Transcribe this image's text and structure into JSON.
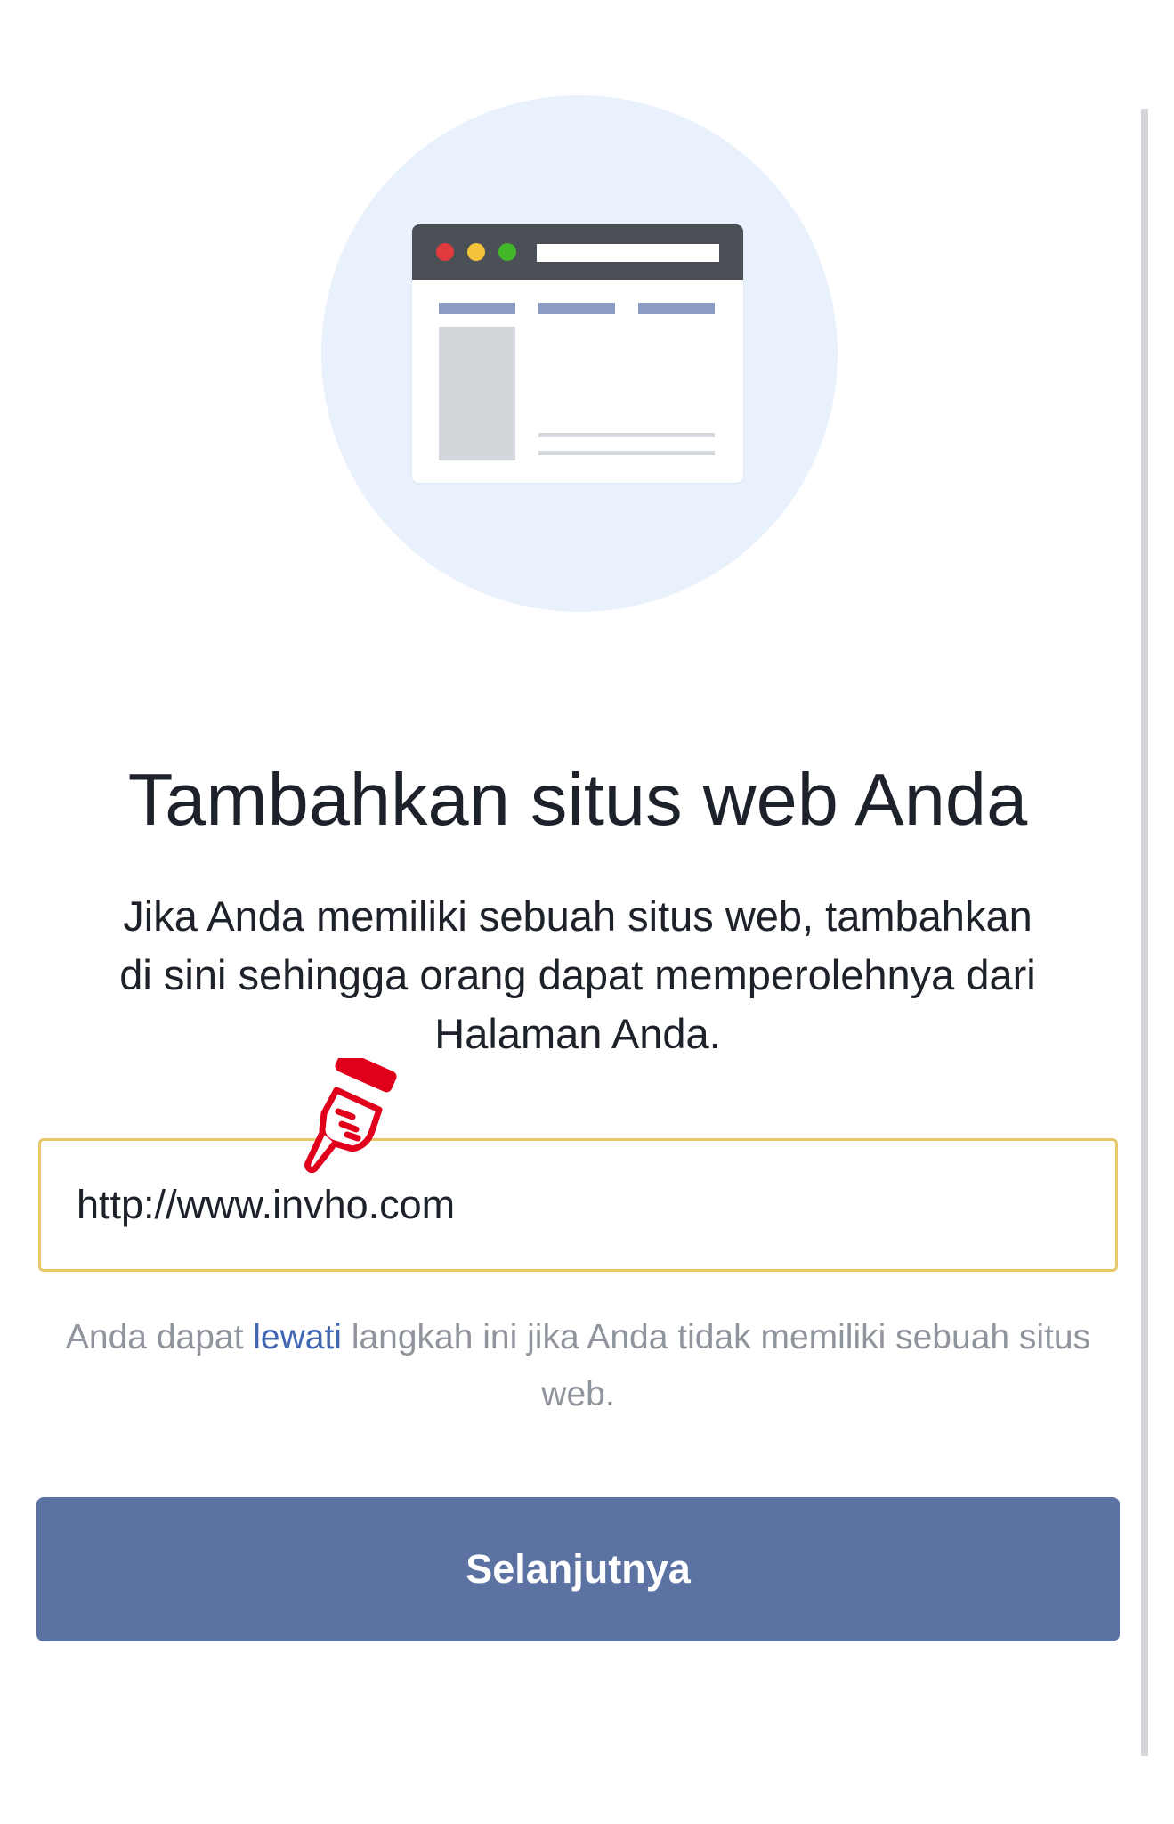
{
  "illustration": {
    "icon": "browser-window-icon",
    "colors": {
      "circle": "#e9f1fd",
      "window_bar": "#4b4f56",
      "dot_red": "#e0393e",
      "dot_yellow": "#f5c33b",
      "dot_green": "#42b72a",
      "nav_lines": "#8b9dc3",
      "placeholder_blocks": "#d3d6db"
    }
  },
  "heading": {
    "title": "Tambahkan situs web Anda",
    "description": "Jika Anda memiliki sebuah situs web, tambahkan di sini sehingga orang dapat memperolehnya dari Halaman Anda."
  },
  "website_input": {
    "value": "http://www.invho.com",
    "border_color": "#e6c76a"
  },
  "hint": {
    "before": "Anda dapat ",
    "link": "lewati",
    "after": " langkah ini jika Anda tidak memiliki sebuah situs web.",
    "link_color": "#4267b2"
  },
  "next_button": {
    "label": "Selanjutnya",
    "color": "#5b72a3"
  },
  "annotation": {
    "icon": "pointing-hand-icon",
    "color": "#e0001b"
  }
}
